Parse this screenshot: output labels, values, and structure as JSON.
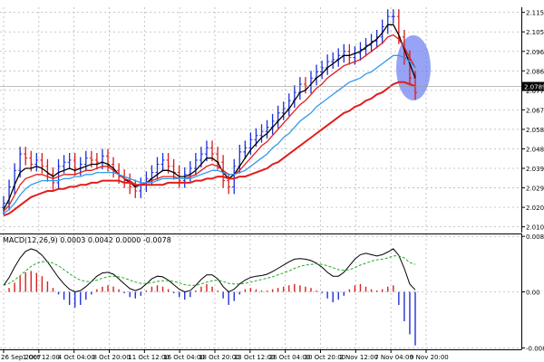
{
  "chart_data": [
    {
      "type": "bar",
      "subtype": "price-bars with moving averages",
      "ylim": [
        2.0077,
        2.1175
      ],
      "y_ticks": [
        "2.1150",
        "2.1055",
        "2.0960",
        "2.0865",
        "2.0770",
        "2.0675",
        "2.0580",
        "2.0485",
        "2.0390",
        "2.0295",
        "2.0200",
        "2.0105"
      ],
      "last_price_label": "2.0789",
      "grid": true,
      "x_ticks": [
        "26 Sep 2007",
        "1 Oct 12:00",
        "4 Oct 04:00",
        "8 Oct 20:00",
        "11 Oct 12:00",
        "16 Oct 04:00",
        "18 Oct 20:00",
        "23 Oct 12:00",
        "26 Oct 04:00",
        "30 Oct 20:00",
        "2 Nov 12:00",
        "7 Nov 04:00",
        "9 Nov 20:00"
      ],
      "price_close": [
        2.022,
        2.03,
        2.038,
        2.046,
        2.044,
        2.041,
        2.043,
        2.04,
        2.036,
        2.032,
        2.04,
        2.042,
        2.043,
        2.039,
        2.041,
        2.044,
        2.043,
        2.042,
        2.045,
        2.041,
        2.038,
        2.035,
        2.033,
        2.03,
        2.028,
        2.031,
        2.034,
        2.037,
        2.041,
        2.043,
        2.04,
        2.037,
        2.033,
        2.036,
        2.039,
        2.043,
        2.046,
        2.049,
        2.046,
        2.042,
        2.033,
        2.03,
        2.04,
        2.047,
        2.049,
        2.053,
        2.055,
        2.057,
        2.059,
        2.062,
        2.066,
        2.068,
        2.072,
        2.076,
        2.08,
        2.079,
        2.083,
        2.086,
        2.088,
        2.091,
        2.092,
        2.094,
        2.096,
        2.093,
        2.095,
        2.097,
        2.099,
        2.101,
        2.103,
        2.108,
        2.113,
        2.113,
        2.103,
        2.093,
        2.083,
        2.076
      ],
      "moving_averages": [
        {
          "color": "#000000",
          "values": [
            2.019,
            2.024,
            2.031,
            2.037,
            2.039,
            2.039,
            2.04,
            2.039,
            2.037,
            2.035,
            2.037,
            2.038,
            2.039,
            2.038,
            2.039,
            2.04,
            2.041,
            2.041,
            2.042,
            2.041,
            2.039,
            2.036,
            2.034,
            2.032,
            2.03,
            2.031,
            2.032,
            2.034,
            2.036,
            2.038,
            2.038,
            2.037,
            2.035,
            2.035,
            2.036,
            2.038,
            2.041,
            2.044,
            2.044,
            2.042,
            2.037,
            2.034,
            2.036,
            2.04,
            2.044,
            2.048,
            2.051,
            2.054,
            2.056,
            2.059,
            2.062,
            2.065,
            2.068,
            2.072,
            2.076,
            2.077,
            2.08,
            2.083,
            2.085,
            2.088,
            2.09,
            2.092,
            2.094,
            2.094,
            2.095,
            2.096,
            2.098,
            2.1,
            2.102,
            2.105,
            2.109,
            2.109,
            2.104,
            2.097,
            2.09,
            2.083
          ]
        },
        {
          "color": "#e11d1d",
          "values": [
            2.018,
            2.021,
            2.026,
            2.031,
            2.034,
            2.035,
            2.036,
            2.036,
            2.035,
            2.034,
            2.035,
            2.036,
            2.036,
            2.036,
            2.037,
            2.038,
            2.038,
            2.039,
            2.04,
            2.04,
            2.038,
            2.036,
            2.034,
            2.033,
            2.031,
            2.031,
            2.032,
            2.033,
            2.034,
            2.035,
            2.035,
            2.035,
            2.034,
            2.034,
            2.035,
            2.036,
            2.038,
            2.04,
            2.041,
            2.04,
            2.038,
            2.036,
            2.036,
            2.038,
            2.041,
            2.044,
            2.047,
            2.05,
            2.052,
            2.055,
            2.058,
            2.061,
            2.064,
            2.067,
            2.07,
            2.072,
            2.075,
            2.078,
            2.08,
            2.083,
            2.085,
            2.087,
            2.089,
            2.09,
            2.091,
            2.092,
            2.094,
            2.096,
            2.098,
            2.1,
            2.103,
            2.104,
            2.102,
            2.098,
            2.093,
            2.088
          ]
        },
        {
          "color": "#3399ee",
          "values": [
            2.017,
            2.019,
            2.022,
            2.026,
            2.029,
            2.031,
            2.032,
            2.033,
            2.033,
            2.033,
            2.033,
            2.034,
            2.034,
            2.035,
            2.035,
            2.036,
            2.036,
            2.037,
            2.037,
            2.037,
            2.037,
            2.036,
            2.035,
            2.034,
            2.033,
            2.032,
            2.032,
            2.032,
            2.033,
            2.034,
            2.034,
            2.034,
            2.034,
            2.034,
            2.034,
            2.035,
            2.036,
            2.037,
            2.038,
            2.038,
            2.037,
            2.036,
            2.036,
            2.037,
            2.038,
            2.04,
            2.042,
            2.044,
            2.046,
            2.049,
            2.051,
            2.054,
            2.056,
            2.059,
            2.062,
            2.064,
            2.066,
            2.069,
            2.071,
            2.073,
            2.075,
            2.077,
            2.079,
            2.081,
            2.082,
            2.083,
            2.085,
            2.086,
            2.088,
            2.09,
            2.092,
            2.094,
            2.094,
            2.093,
            2.091,
            2.088
          ]
        },
        {
          "color": "#e11d1d",
          "values": [
            2.016,
            2.017,
            2.019,
            2.021,
            2.023,
            2.025,
            2.026,
            2.027,
            2.028,
            2.028,
            2.029,
            2.029,
            2.03,
            2.03,
            2.031,
            2.031,
            2.032,
            2.032,
            2.033,
            2.033,
            2.033,
            2.033,
            2.032,
            2.032,
            2.031,
            2.031,
            2.031,
            2.031,
            2.031,
            2.031,
            2.032,
            2.032,
            2.032,
            2.032,
            2.032,
            2.033,
            2.033,
            2.034,
            2.034,
            2.035,
            2.035,
            2.034,
            2.034,
            2.035,
            2.035,
            2.036,
            2.037,
            2.038,
            2.039,
            2.041,
            2.042,
            2.044,
            2.046,
            2.048,
            2.05,
            2.052,
            2.054,
            2.056,
            2.058,
            2.06,
            2.062,
            2.064,
            2.066,
            2.067,
            2.069,
            2.07,
            2.072,
            2.073,
            2.075,
            2.076,
            2.078,
            2.08,
            2.081,
            2.081,
            2.08,
            2.079
          ]
        }
      ]
    },
    {
      "type": "bar",
      "subtype": "MACD histogram with lines",
      "title": "MACD(12,26,9) 0.0003 0.0042 0.0000 -0.0078",
      "ylim": [
        -0.0088,
        0.0088
      ],
      "y_ticks": [
        "0.0085",
        "0.00",
        "-0.0086"
      ],
      "grid": true,
      "histogram": [
        0.0,
        0.0006,
        0.0014,
        0.0024,
        0.003,
        0.0032,
        0.0029,
        0.0024,
        0.0016,
        0.0006,
        -0.0004,
        -0.0012,
        -0.002,
        -0.0024,
        -0.002,
        -0.0012,
        -0.0004,
        0.0004,
        0.0008,
        0.001,
        0.0008,
        0.0004,
        -0.0002,
        -0.0008,
        -0.001,
        -0.0006,
        0.0002,
        0.0008,
        0.001,
        0.0008,
        0.0004,
        -0.0002,
        -0.0008,
        -0.0012,
        -0.0008,
        0.0002,
        0.0008,
        0.0012,
        0.0008,
        0.0002,
        -0.001,
        -0.002,
        -0.0014,
        -0.0004,
        0.0004,
        0.0006,
        0.0004,
        0.0002,
        0.0002,
        0.0004,
        0.0006,
        0.0008,
        0.001,
        0.0012,
        0.001,
        0.0008,
        0.0006,
        0.0002,
        -0.0002,
        -0.001,
        -0.0016,
        -0.0012,
        -0.0006,
        0.0004,
        0.001,
        0.0012,
        0.0008,
        0.0004,
        0.0002,
        0.0004,
        0.0008,
        0.001,
        -0.002,
        -0.0045,
        -0.0065,
        -0.0082
      ],
      "macd_line": [
        0.001,
        0.0022,
        0.0038,
        0.0052,
        0.0062,
        0.0066,
        0.0063,
        0.0056,
        0.0046,
        0.0034,
        0.0022,
        0.0012,
        0.0004,
        0.0,
        0.0002,
        0.0008,
        0.0016,
        0.0024,
        0.0029,
        0.003,
        0.0027,
        0.002,
        0.0012,
        0.0005,
        0.0002,
        0.0005,
        0.0012,
        0.002,
        0.0024,
        0.0023,
        0.0018,
        0.0011,
        0.0004,
        0.0,
        0.0002,
        0.001,
        0.0019,
        0.0026,
        0.0026,
        0.002,
        0.0008,
        0.0,
        0.0004,
        0.0012,
        0.0018,
        0.0022,
        0.0024,
        0.0025,
        0.0027,
        0.0031,
        0.0036,
        0.0041,
        0.0046,
        0.005,
        0.0051,
        0.005,
        0.0048,
        0.0044,
        0.0038,
        0.003,
        0.0024,
        0.0024,
        0.003,
        0.004,
        0.005,
        0.0057,
        0.0059,
        0.0057,
        0.0055,
        0.0057,
        0.0061,
        0.0066,
        0.0056,
        0.0036,
        0.0012,
        0.0003
      ],
      "signal_line": [
        0.001,
        0.0013,
        0.0018,
        0.0025,
        0.0032,
        0.0039,
        0.0044,
        0.0046,
        0.0046,
        0.0044,
        0.004,
        0.0034,
        0.0028,
        0.0022,
        0.0018,
        0.0016,
        0.0016,
        0.0018,
        0.0021,
        0.0023,
        0.0024,
        0.0023,
        0.0021,
        0.0018,
        0.0015,
        0.0013,
        0.0013,
        0.0014,
        0.0016,
        0.0017,
        0.0017,
        0.0016,
        0.0014,
        0.0011,
        0.001,
        0.001,
        0.0012,
        0.0015,
        0.0017,
        0.0018,
        0.0016,
        0.0013,
        0.0012,
        0.0012,
        0.0013,
        0.0015,
        0.0017,
        0.0019,
        0.0021,
        0.0023,
        0.0026,
        0.0029,
        0.0032,
        0.0036,
        0.0039,
        0.0041,
        0.0042,
        0.0043,
        0.0042,
        0.004,
        0.0037,
        0.0034,
        0.0033,
        0.0034,
        0.0037,
        0.0041,
        0.0044,
        0.0047,
        0.0049,
        0.005,
        0.0052,
        0.0055,
        0.0055,
        0.0052,
        0.0045,
        0.0042
      ]
    }
  ]
}
